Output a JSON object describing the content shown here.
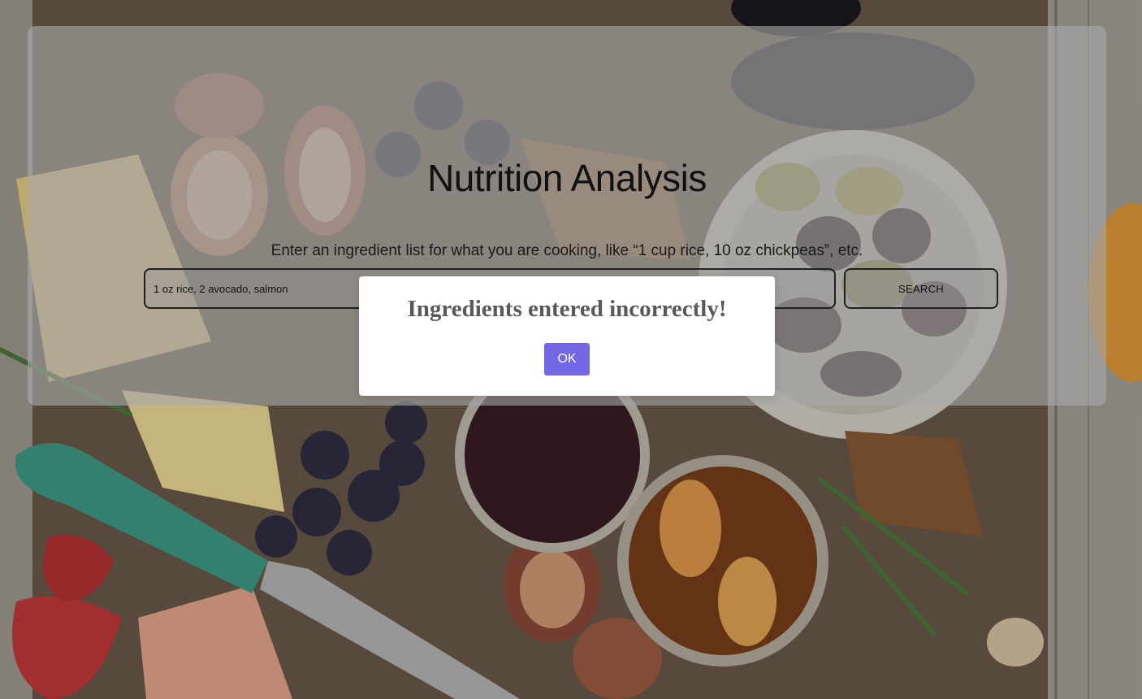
{
  "page": {
    "title": "Nutrition Analysis",
    "subtitle": "Enter an ingredient list for what you are cooking, like “1 cup rice, 10 oz chickpeas”, etc."
  },
  "search": {
    "value": "1 oz rice, 2 avocado, salmon",
    "button_label": "SEARCH"
  },
  "alert": {
    "message": "Ingredients entered incorrectly!",
    "ok_label": "OK",
    "ok_color": "#7367e3"
  }
}
